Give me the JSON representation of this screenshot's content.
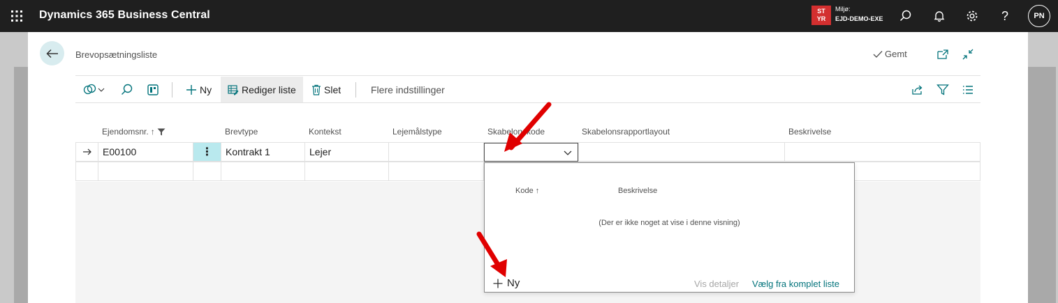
{
  "topbar": {
    "app_title": "Dynamics 365 Business Central",
    "env_badge_line1": "ST",
    "env_badge_line2": "YR",
    "env_label": "Miljø:",
    "env_value": "EJD-DEMO-EXE",
    "avatar_initials": "PN",
    "icons": [
      "waffle-icon",
      "search-icon",
      "bell-icon",
      "gear-icon",
      "help-icon"
    ]
  },
  "page": {
    "title": "Brevopsætningsliste",
    "saved_label": "Gemt"
  },
  "actions": {
    "new_label": "Ny",
    "edit_list_label": "Rediger liste",
    "delete_label": "Slet",
    "more_options_label": "Flere indstillinger"
  },
  "table": {
    "columns": [
      "Ejendomsnr.",
      "Brevtype",
      "Kontekst",
      "Lejemålstype",
      "Skabelonskode",
      "Skabelonsrapportlayout",
      "Beskrivelse"
    ],
    "sort_indicator": "↑",
    "rows": [
      {
        "ejendomsnr": "E00100",
        "brevtype": "Kontrakt 1",
        "kontekst": "Lejer",
        "lejemaalstype": "",
        "skabelonskode": "",
        "layout": "",
        "beskrivelse": ""
      }
    ]
  },
  "lookup": {
    "col_code": "Kode",
    "col_code_sort": "↑",
    "col_description": "Beskrivelse",
    "empty_message": "(Der er ikke noget at vise i denne visning)",
    "new_label": "Ny",
    "show_details_label": "Vis detaljer",
    "choose_full_list_label": "Vælg fra komplet liste"
  },
  "colors": {
    "accent": "#00727a",
    "annotation_arrow": "#e00000",
    "badge": "#d32f2f"
  }
}
